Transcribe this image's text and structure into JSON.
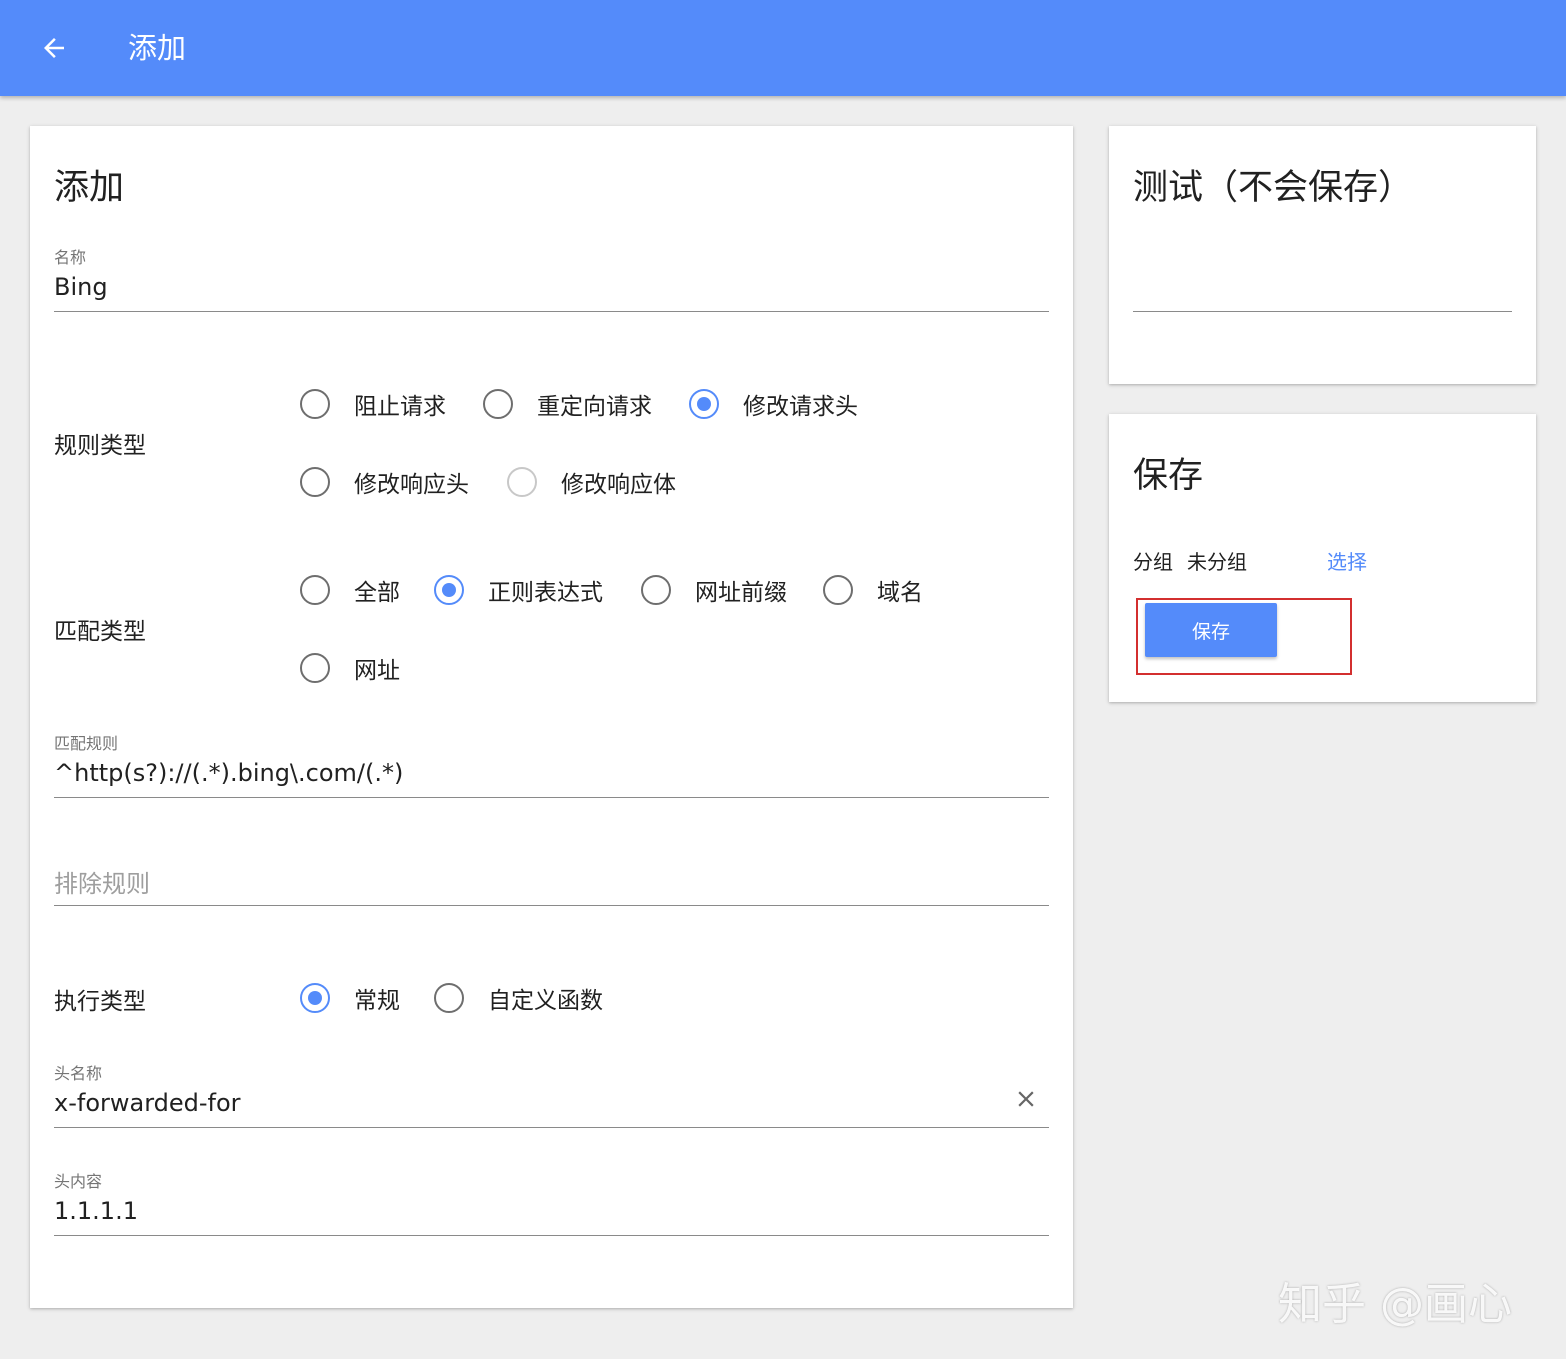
{
  "appbar": {
    "title": "添加",
    "back_icon": "arrow-left-icon",
    "color": "#548bfa"
  },
  "main": {
    "title": "添加",
    "name_field": {
      "label": "名称",
      "value": "Bing"
    },
    "rule_type": {
      "label": "规则类型",
      "options": [
        {
          "label": "阻止请求",
          "checked": false,
          "disabled": false
        },
        {
          "label": "重定向请求",
          "checked": false,
          "disabled": false
        },
        {
          "label": "修改请求头",
          "checked": true,
          "disabled": false
        },
        {
          "label": "修改响应头",
          "checked": false,
          "disabled": false
        },
        {
          "label": "修改响应体",
          "checked": false,
          "disabled": true
        }
      ]
    },
    "match_type": {
      "label": "匹配类型",
      "options": [
        {
          "label": "全部",
          "checked": false
        },
        {
          "label": "正则表达式",
          "checked": true
        },
        {
          "label": "网址前缀",
          "checked": false
        },
        {
          "label": "域名",
          "checked": false
        },
        {
          "label": "网址",
          "checked": false
        }
      ]
    },
    "match_rule_field": {
      "label": "匹配规则",
      "value": "^http(s?)://(.*).bing\\.com/(.*)"
    },
    "exclude_rule_field": {
      "placeholder": "排除规则",
      "value": ""
    },
    "exec_type": {
      "label": "执行类型",
      "options": [
        {
          "label": "常规",
          "checked": true
        },
        {
          "label": "自定义函数",
          "checked": false
        }
      ]
    },
    "header_name_field": {
      "label": "头名称",
      "value": "x-forwarded-for",
      "clear_icon": "close-icon"
    },
    "header_value_field": {
      "label": "头内容",
      "value": "1.1.1.1"
    }
  },
  "test_card": {
    "title": "测试（不会保存）",
    "input_value": ""
  },
  "save_card": {
    "title": "保存",
    "group_label": "分组",
    "group_value": "未分组",
    "select_label": "选择",
    "save_button_label": "保存",
    "highlight_color": "#d32f2f"
  },
  "watermark": "知乎 @画心"
}
